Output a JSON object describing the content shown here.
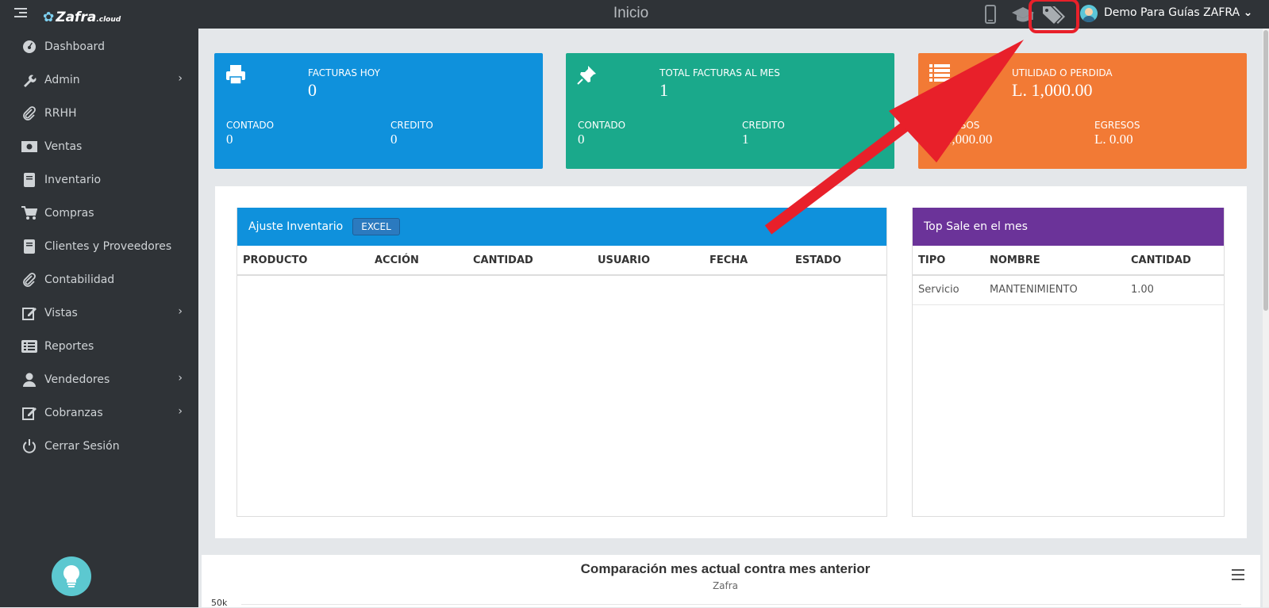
{
  "app": {
    "logo_text": "Zafra",
    "logo_suffix": ".cloud",
    "page_title": "Inicio"
  },
  "header": {
    "user_name": "Demo Para Guías ZAFRA"
  },
  "sidebar": {
    "items": [
      {
        "label": "Dashboard",
        "icon": "dashboard-icon"
      },
      {
        "label": "Admin",
        "icon": "wrench-icon",
        "has_submenu": true
      },
      {
        "label": "RRHH",
        "icon": "paperclip-icon"
      },
      {
        "label": "Ventas",
        "icon": "money-icon"
      },
      {
        "label": "Inventario",
        "icon": "book-icon"
      },
      {
        "label": "Compras",
        "icon": "cart-icon"
      },
      {
        "label": "Clientes y Proveedores",
        "icon": "book-icon"
      },
      {
        "label": "Contabilidad",
        "icon": "paperclip-icon"
      },
      {
        "label": "Vistas",
        "icon": "edit-icon",
        "has_submenu": true
      },
      {
        "label": "Reportes",
        "icon": "list-icon"
      },
      {
        "label": "Vendedores",
        "icon": "user-icon",
        "has_submenu": true
      },
      {
        "label": "Cobranzas",
        "icon": "edit-icon",
        "has_submenu": true
      },
      {
        "label": "Cerrar Sesión",
        "icon": "power-icon"
      }
    ]
  },
  "cards": [
    {
      "title": "FACTURAS HOY",
      "value": "0",
      "left_label": "CONTADO",
      "left_value": "0",
      "right_label": "CREDITO",
      "right_value": "0",
      "color": "#0f91dc",
      "icon": "print-icon"
    },
    {
      "title": "TOTAL FACTURAS AL MES",
      "value": "1",
      "left_label": "CONTADO",
      "left_value": "0",
      "right_label": "CREDITO",
      "right_value": "1",
      "color": "#1aa98b",
      "icon": "pin-icon"
    },
    {
      "title": "UTILIDAD O PERDIDA",
      "value": "L. 1,000.00",
      "left_label": "INGRESOS",
      "left_value": "L. 1,000.00",
      "right_label": "EGRESOS",
      "right_value": "L. 0.00",
      "color": "#f27a35",
      "icon": "list-icon"
    }
  ],
  "inventory": {
    "title": "Ajuste Inventario",
    "excel_label": "EXCEL",
    "columns": [
      "PRODUCTO",
      "ACCIÓN",
      "CANTIDAD",
      "USUARIO",
      "FECHA",
      "ESTADO"
    ],
    "rows": []
  },
  "top_sale": {
    "title": "Top Sale en el mes",
    "columns": [
      "TIPO",
      "NOMBRE",
      "CANTIDAD"
    ],
    "rows": [
      [
        "Servicio",
        "MANTENIMIENTO",
        "1.00"
      ]
    ]
  },
  "chart_data": {
    "type": "line",
    "title": "Comparación mes actual contra mes anterior",
    "subtitle": "Zafra",
    "y_ticks": [
      "50k"
    ]
  },
  "colors": {
    "topbar": "#2f3337",
    "sidebar": "#2f3337",
    "inventory_header": "#0f91dc",
    "top_sale_header": "#6b3399",
    "annotation": "#e8202a"
  }
}
